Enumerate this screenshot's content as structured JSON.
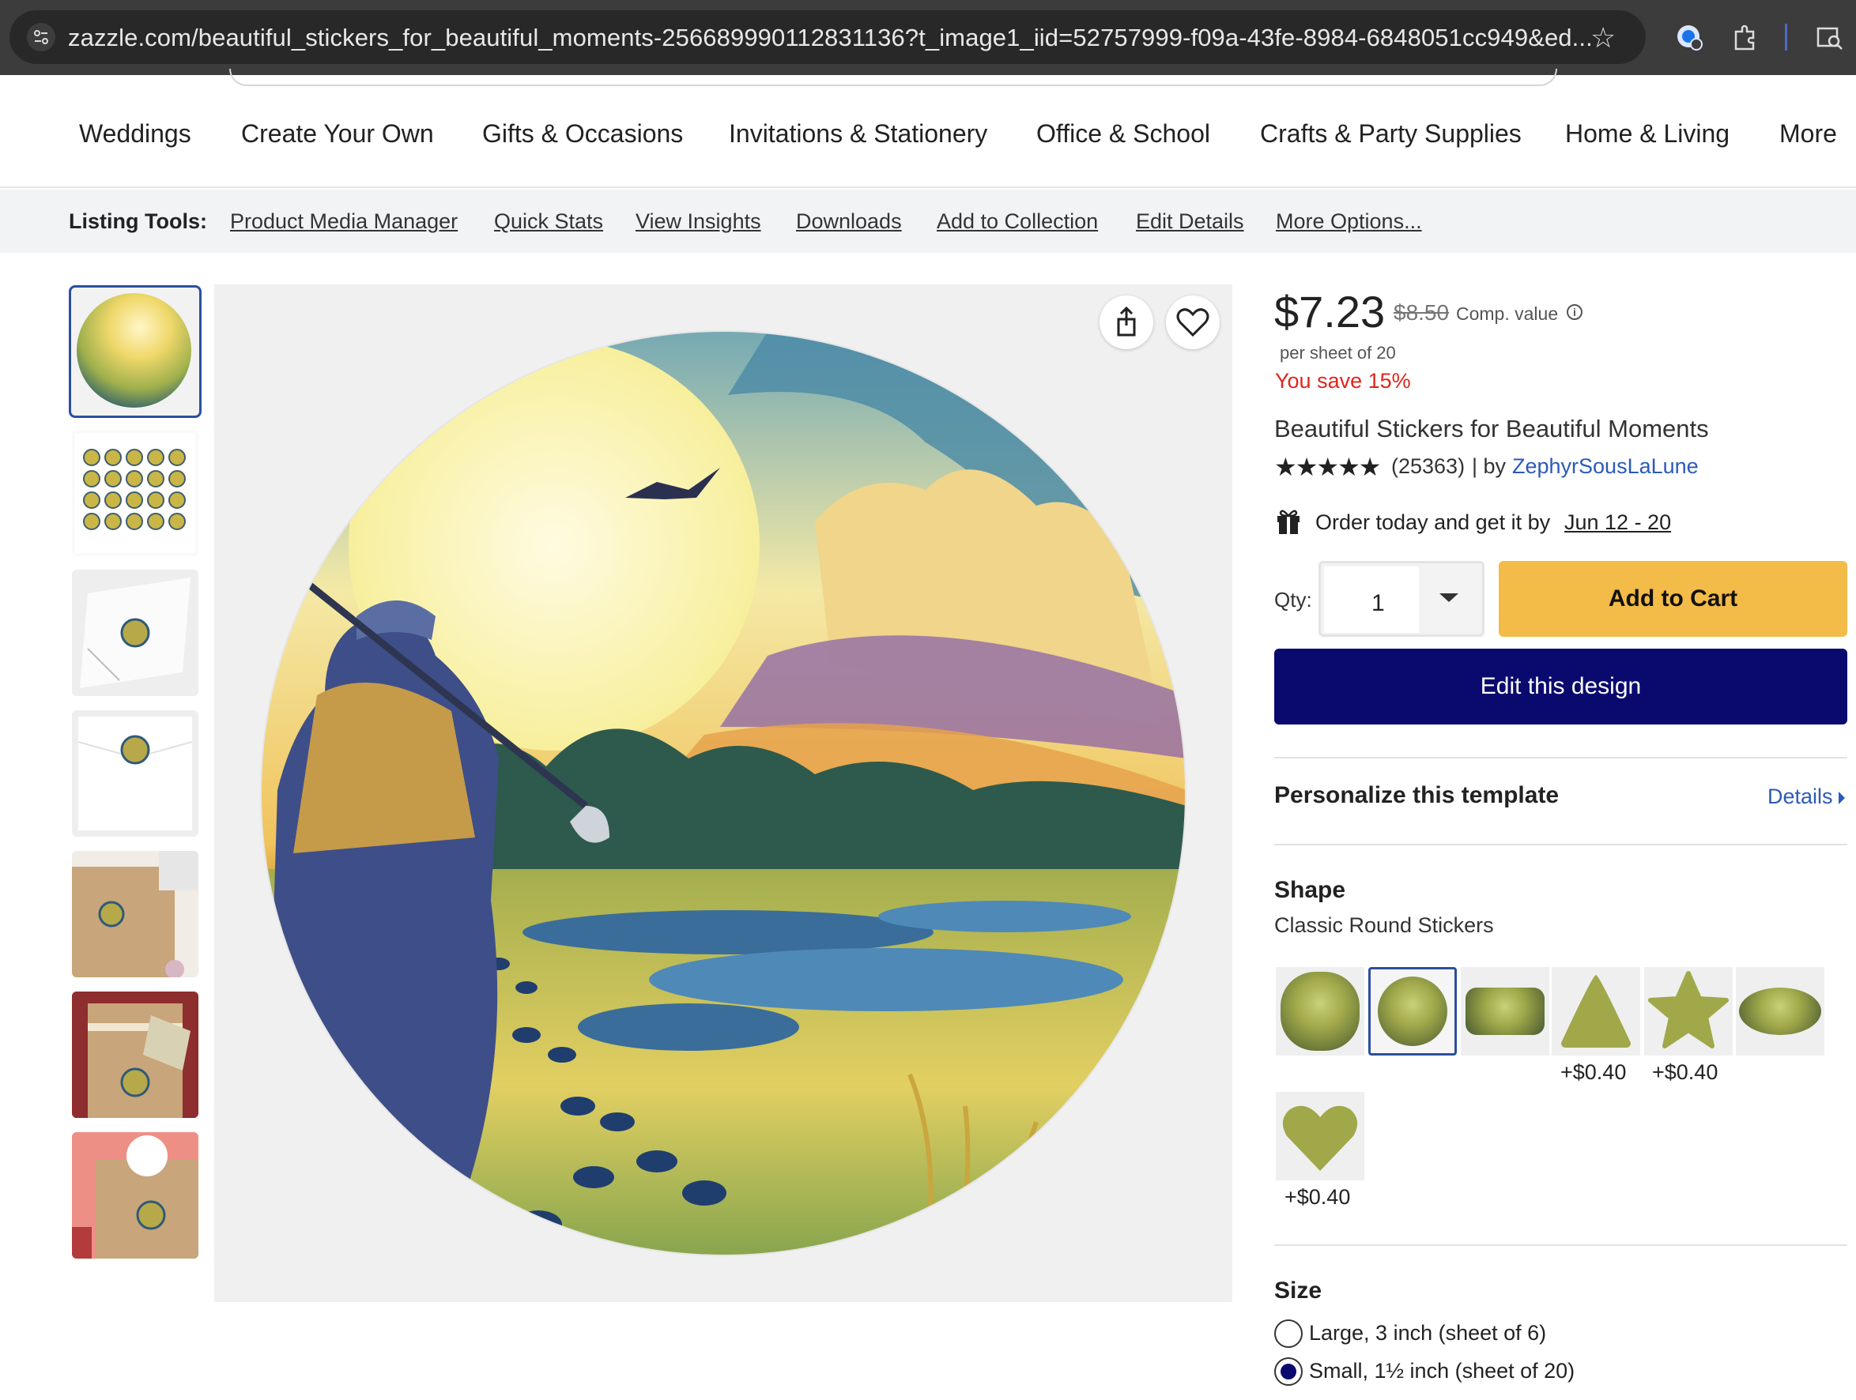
{
  "browser": {
    "url": "zazzle.com/beautiful_stickers_for_beautiful_moments-256689990112831136?t_image1_iid=52757999-f09a-43fe-8984-6848051cc949&ed..."
  },
  "nav": {
    "items": [
      "Weddings",
      "Create Your Own",
      "Gifts & Occasions",
      "Invitations & Stationery",
      "Office & School",
      "Crafts & Party Supplies",
      "Home & Living",
      "More"
    ]
  },
  "listing_tools": {
    "label": "Listing Tools:",
    "links": [
      "Product Media Manager",
      "Quick Stats",
      "View Insights",
      "Downloads",
      "Add to Collection",
      "Edit Details",
      "More Options..."
    ]
  },
  "product": {
    "price": "$7.23",
    "original_price": "$8.50",
    "comp_value": "Comp. value",
    "per_sheet": "per sheet of 20",
    "save": "You save 15%",
    "title": "Beautiful Stickers for Beautiful Moments",
    "stars": "★★★★★",
    "rating_value": 5,
    "reviews": "(25363)",
    "by": "| by",
    "author": "ZephyrSousLaLune",
    "order_text": "Order today and get it by",
    "order_date": "Jun 12 - 20"
  },
  "purchase": {
    "qty_label": "Qty:",
    "qty_value": "1",
    "add_to_cart": "Add to Cart",
    "edit_design": "Edit this design"
  },
  "personalize": {
    "title": "Personalize this template",
    "details": "Details"
  },
  "shape": {
    "title": "Shape",
    "selected": "Classic Round Stickers",
    "options": [
      {
        "shape": "rounded-square",
        "price": ""
      },
      {
        "shape": "circle",
        "price": "",
        "selected": true
      },
      {
        "shape": "rectangle",
        "price": ""
      },
      {
        "shape": "triangle",
        "price": "+$0.40"
      },
      {
        "shape": "star",
        "price": "+$0.40"
      },
      {
        "shape": "oval",
        "price": ""
      },
      {
        "shape": "heart",
        "price": "+$0.40"
      }
    ]
  },
  "size": {
    "title": "Size",
    "options": [
      {
        "label": "Large, 3 inch (sheet of 6)",
        "checked": false
      },
      {
        "label": "Small, 1½ inch (sheet of 20)",
        "checked": true
      }
    ]
  },
  "colors": {
    "accent_blue": "#2c4f9e",
    "cart_yellow": "#f3bb47",
    "edit_navy": "#0a0a6e",
    "save_red": "#e0251b",
    "link_blue": "#2b5ab8"
  }
}
